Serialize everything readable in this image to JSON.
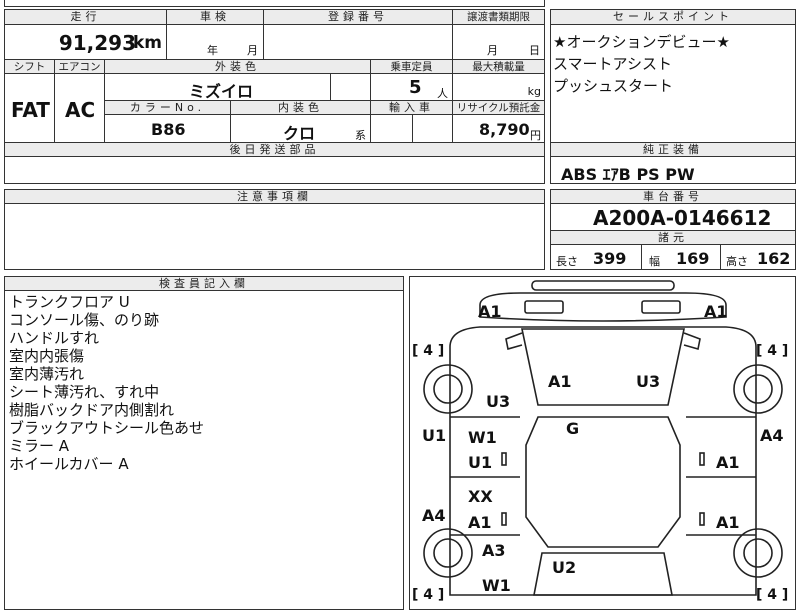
{
  "top_table": {
    "headers": {
      "mileage": "走行",
      "inspection": "車検",
      "registration": "登録番号",
      "transfer_deadline": "譲渡書類期限",
      "shift": "シフト",
      "aircon": "エアコン",
      "exterior_color": "外装色",
      "capacity": "乗車定員",
      "max_load": "最大積載量",
      "color_no": "カラーNo.",
      "interior_color": "内装色",
      "import": "輸入車",
      "recycle": "リサイクル預託金",
      "deferred_parts": "後日発送部品"
    },
    "values": {
      "mileage": "91,293",
      "mileage_unit": "km",
      "year_unit": "年",
      "month_unit": "月",
      "month2": "月",
      "day": "日",
      "shift": "FAT",
      "aircon": "AC",
      "exterior_color": "ミズイロ",
      "capacity": "5",
      "capacity_unit": "人",
      "load_unit": "kg",
      "color_no": "B86",
      "interior_color": "クロ",
      "interior_suffix": "系",
      "recycle": "8,790",
      "recycle_unit": "円"
    }
  },
  "sales_point": {
    "header": "セールスポイント",
    "lines": [
      "★オークションデビュー★",
      "スマートアシスト",
      "プッシュスタート"
    ]
  },
  "equipment": {
    "header": "純正装備",
    "value": "ABS ｴｱB PS PW"
  },
  "notes": {
    "header": "注意事項欄"
  },
  "chassis": {
    "header": "車台番号",
    "value": "A200A-0146612"
  },
  "specs": {
    "header": "諸元",
    "length_label": "長さ",
    "length": "399",
    "width_label": "幅",
    "width": "169",
    "height_label": "高さ",
    "height": "162"
  },
  "inspector": {
    "header": "検査員記入欄",
    "lines": [
      "トランクフロア U",
      "コンソール傷、のり跡",
      "ハンドルすれ",
      "室内内張傷",
      "室内薄汚れ",
      "シート薄汚れ、すれ中",
      "樹脂バックドア内側割れ",
      "ブラックアウトシール色あせ",
      "ミラー A",
      "ホイールカバー A"
    ]
  },
  "diagram": {
    "labels": {
      "front_left_top": "A1",
      "front_right_top": "A1",
      "tire_fl": "[ 4 ]",
      "tire_fr": "[ 4 ]",
      "tire_rl": "[ 4 ]",
      "tire_rr": "[ 4 ]",
      "hood_left": "A1",
      "hood_right": "U3",
      "fender_left": "U3",
      "windshield": "G",
      "pillar_left": "U1",
      "pillar_right": "A4",
      "door_fl_1": "W1",
      "door_fl_2": "U1",
      "door_fr": "A1",
      "door_rl_1": "XX",
      "door_rl_2": "A1",
      "door_rr": "A1",
      "rocker_left": "A4",
      "rear_fender_left": "A3",
      "rear_center": "U2",
      "rear_bottom_left": "W1"
    }
  }
}
